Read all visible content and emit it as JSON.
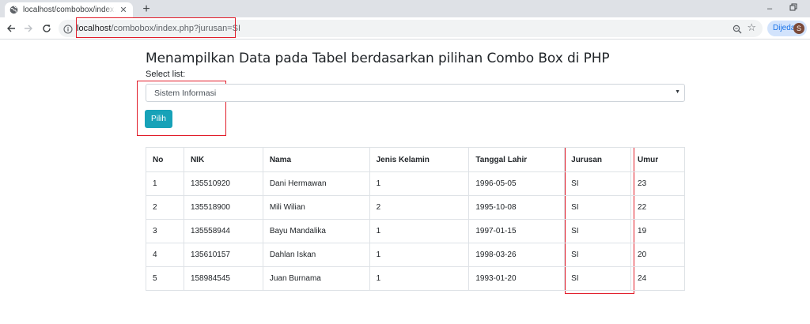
{
  "browser": {
    "tab_title": "localhost/combobox/index.php?jurusan=SI",
    "url_host": "localhost",
    "url_path": "/combobox/index.php?jurusan=SI",
    "profile_name": "Dijeda",
    "avatar_initial": "S"
  },
  "page": {
    "title": "Menampilkan Data pada Tabel berdasarkan pilihan Combo Box di PHP",
    "select_label": "Select list:",
    "select_value": "Sistem Informasi",
    "button_label": "Pilih"
  },
  "table": {
    "headers": [
      "No",
      "NIK",
      "Nama",
      "Jenis Kelamin",
      "Tanggal Lahir",
      "Jurusan",
      "Umur"
    ],
    "rows": [
      [
        "1",
        "135510920",
        "Dani Hermawan",
        "1",
        "1996-05-05",
        "SI",
        "23"
      ],
      [
        "2",
        "135518900",
        "Mili Wilian",
        "2",
        "1995-10-08",
        "SI",
        "22"
      ],
      [
        "3",
        "135558944",
        "Bayu Mandalika",
        "1",
        "1997-01-15",
        "SI",
        "19"
      ],
      [
        "4",
        "135610157",
        "Dahlan Iskan",
        "1",
        "1998-03-26",
        "SI",
        "20"
      ],
      [
        "5",
        "158984545",
        "Juan Burnama",
        "1",
        "1993-01-20",
        "SI",
        "24"
      ]
    ]
  },
  "colors": {
    "annotation": "#e11d2a",
    "button": "#17a2b8"
  },
  "icons": [
    "globe-icon",
    "close-icon",
    "plus-icon",
    "back-icon",
    "forward-icon",
    "reload-icon",
    "info-icon",
    "zoom-icon",
    "star-icon",
    "minimize-icon",
    "restore-icon"
  ]
}
